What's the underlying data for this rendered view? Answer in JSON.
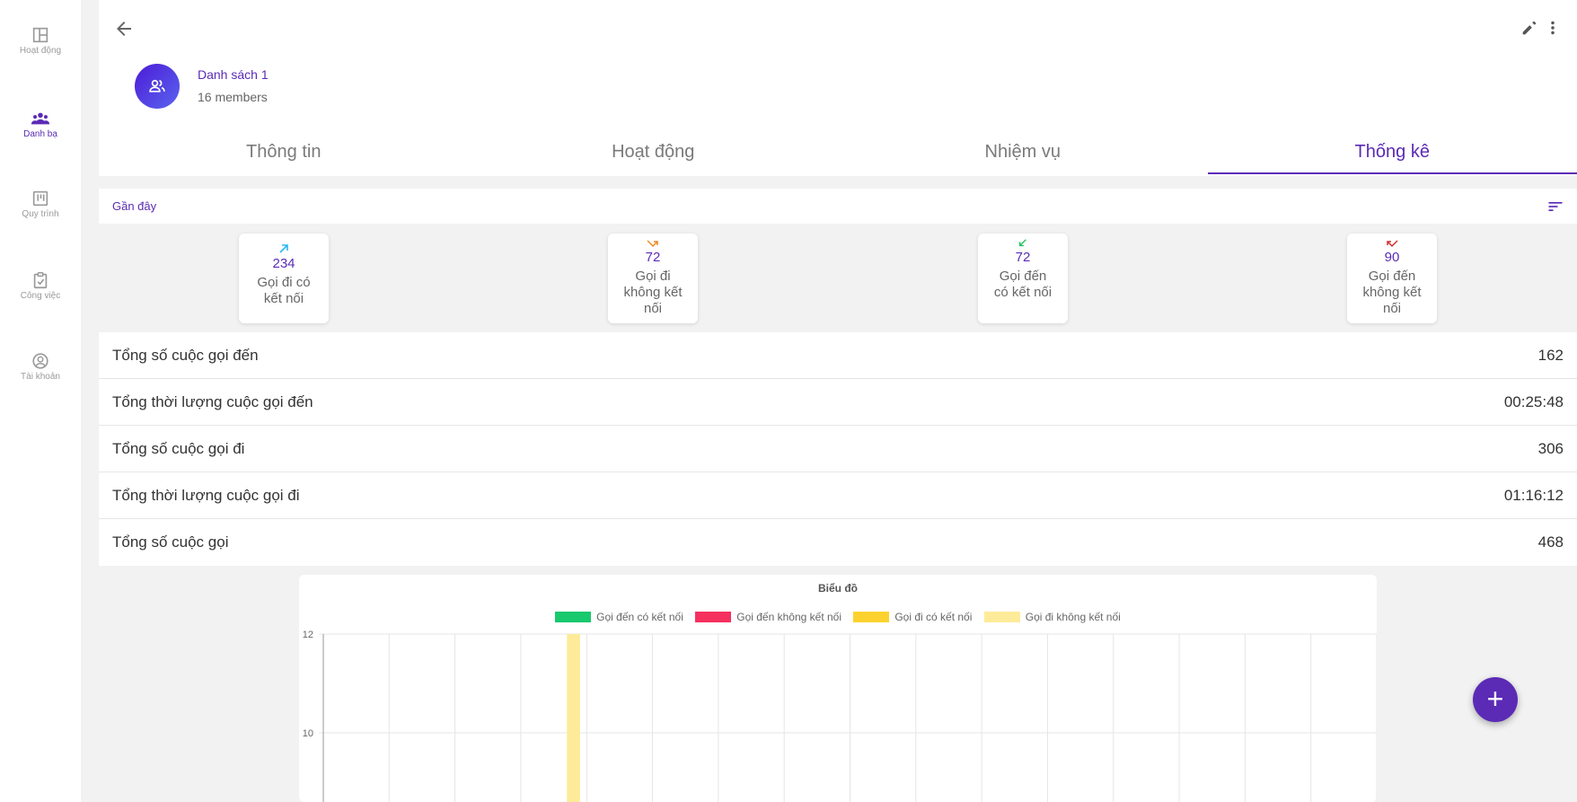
{
  "sidebar": {
    "items": [
      {
        "label": "Hoạt động",
        "icon": "dashboard-icon"
      },
      {
        "label": "Danh bạ",
        "icon": "contacts-icon",
        "active": true
      },
      {
        "label": "Quy trình",
        "icon": "kanban-icon"
      },
      {
        "label": "Công việc",
        "icon": "clipboard-check-icon"
      },
      {
        "label": "Tài khoản",
        "icon": "account-circle-icon"
      }
    ]
  },
  "header": {
    "list_name": "Danh sách 1",
    "members": "16 members"
  },
  "tabs": [
    {
      "label": "Thông tin"
    },
    {
      "label": "Hoạt động"
    },
    {
      "label": "Nhiệm vụ"
    },
    {
      "label": "Thống kê",
      "active": true
    }
  ],
  "filter": {
    "label": "Gần đây"
  },
  "stats": [
    {
      "value": "234",
      "caption": "Gọi đi có kết nối",
      "color": "#29b6f6"
    },
    {
      "value": "72",
      "caption": "Gọi đi không kết nối",
      "color": "#ef8a1f"
    },
    {
      "value": "72",
      "caption": "Gọi đến có kết nối",
      "color": "#18c05a"
    },
    {
      "value": "90",
      "caption": "Gọi đến không kết nối",
      "color": "#d32f2f"
    }
  ],
  "summary": [
    {
      "label": "Tổng số cuộc gọi đến",
      "value": "162"
    },
    {
      "label": "Tổng thời lượng cuộc gọi đến",
      "value": "00:25:48"
    },
    {
      "label": "Tổng số cuộc gọi đi",
      "value": "306"
    },
    {
      "label": "Tổng thời lượng cuộc gọi đi",
      "value": "01:16:12"
    },
    {
      "label": "Tổng số cuộc gọi",
      "value": "468"
    }
  ],
  "chart_data": {
    "type": "bar",
    "title": "Biểu đồ",
    "y_ticks": [
      12,
      10
    ],
    "ylim_visible": [
      8.6,
      12
    ],
    "categories_count": 16,
    "series": [
      {
        "name": "Gọi đến có kết nối",
        "color": "#18c96e",
        "values": [
          0,
          0,
          0,
          0,
          0,
          0,
          0,
          0,
          0,
          0,
          0,
          0,
          0,
          0,
          0,
          0
        ]
      },
      {
        "name": "Gọi đến không kết nối",
        "color": "#f5305f",
        "values": [
          0,
          0,
          0,
          0,
          0,
          0,
          0,
          0,
          0,
          0,
          0,
          0,
          0,
          0,
          0,
          0
        ]
      },
      {
        "name": "Gọi đi có kết nối",
        "color": "#fdd22f",
        "values": [
          0,
          0,
          0,
          0,
          0,
          0,
          0,
          0,
          0,
          0,
          0,
          0,
          0,
          0,
          0,
          0
        ]
      },
      {
        "name": "Gọi đi không kết nối",
        "color": "#feeb9a",
        "values": [
          0,
          0,
          0,
          12,
          0,
          0,
          0,
          0,
          0,
          0,
          0,
          0,
          0,
          0,
          0,
          0
        ]
      }
    ]
  },
  "colors": {
    "accent": "#5b2bb5"
  }
}
